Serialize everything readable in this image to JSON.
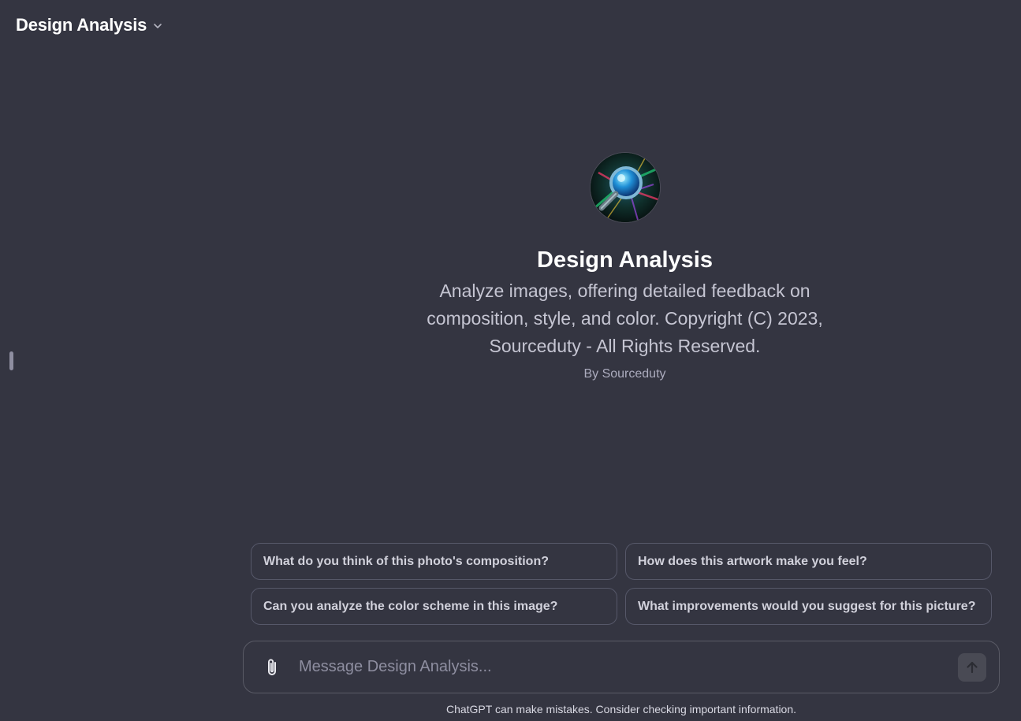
{
  "header": {
    "title": "Design Analysis",
    "dropdown_icon": "chevron-down-icon"
  },
  "gpt": {
    "name": "Design Analysis",
    "description": "Analyze images, offering detailed feedback on composition, style, and color. Copyright (C) 2023, Sourceduty - All Rights Reserved.",
    "author": "By Sourceduty",
    "avatar_icon": "magnifying-glass-art-icon"
  },
  "suggestions": [
    "What do you think of this photo's composition?",
    "How does this artwork make you feel?",
    "Can you analyze the color scheme in this image?",
    "What improvements would you suggest for this picture?"
  ],
  "composer": {
    "placeholder": "Message Design Analysis...",
    "attach_icon": "paperclip-icon",
    "send_icon": "arrow-up-icon"
  },
  "footer": {
    "disclaimer": "ChatGPT can make mistakes. Consider checking important information."
  },
  "colors": {
    "background": "#343541",
    "border": "#565869",
    "send_button": "#494a54"
  }
}
